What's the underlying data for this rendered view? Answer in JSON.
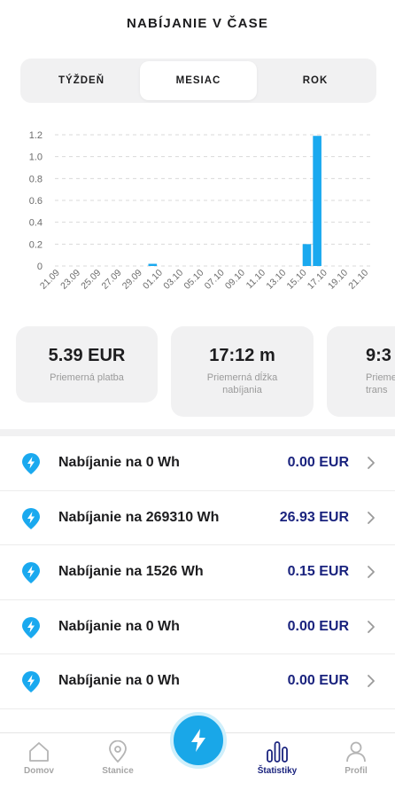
{
  "header": {
    "title": "NABÍJANIE V ČASE"
  },
  "period_tabs": [
    {
      "label": "TÝŽDEŇ",
      "active": false
    },
    {
      "label": "MESIAC",
      "active": true
    },
    {
      "label": "ROK",
      "active": false
    }
  ],
  "chart_data": {
    "type": "bar",
    "categories": [
      "21.09",
      "22.09",
      "23.09",
      "24.09",
      "25.09",
      "26.09",
      "27.09",
      "28.09",
      "29.09",
      "30.09",
      "01.10",
      "02.10",
      "03.10",
      "04.10",
      "05.10",
      "06.10",
      "07.10",
      "08.10",
      "09.10",
      "10.10",
      "11.10",
      "12.10",
      "13.10",
      "14.10",
      "15.10",
      "16.10",
      "17.10",
      "18.10",
      "19.10",
      "20.10",
      "21.10"
    ],
    "tick_labels": [
      "21.09",
      "23.09",
      "25.09",
      "27.09",
      "29.09",
      "01.10",
      "03.10",
      "05.10",
      "07.10",
      "09.10",
      "11.10",
      "13.10",
      "15.10",
      "17.10",
      "19.10",
      "21.10"
    ],
    "values": [
      0,
      0,
      0,
      0,
      0,
      0,
      0,
      0,
      0,
      0.02,
      0,
      0,
      0,
      0,
      0,
      0,
      0,
      0,
      0,
      0,
      0,
      0,
      0,
      0,
      0.2,
      1.19,
      0,
      0,
      0,
      0,
      0
    ],
    "yticks": [
      0,
      0.2,
      0.4,
      0.6,
      0.8,
      1.0,
      1.2
    ],
    "ytick_labels": [
      "0",
      "0.2",
      "0.4",
      "0.6",
      "0.8",
      "1.0",
      "1.2"
    ],
    "ylim": [
      0,
      1.2
    ],
    "grid": true,
    "bar_color": "#1aa9ef",
    "title": "",
    "xlabel": "",
    "ylabel": ""
  },
  "summary_cards": [
    {
      "value": "5.39 EUR",
      "label": "Priemerná platba"
    },
    {
      "value": "17:12 m",
      "label": "Priemerná dĺžka\nnabíjania"
    },
    {
      "value": "9:3",
      "label": "Prieme\ntrans"
    }
  ],
  "sessions": [
    {
      "title": "Nabíjanie na 0 Wh",
      "amount": "0.00 EUR"
    },
    {
      "title": "Nabíjanie na 269310 Wh",
      "amount": "26.93 EUR"
    },
    {
      "title": "Nabíjanie na 1526 Wh",
      "amount": "0.15 EUR"
    },
    {
      "title": "Nabíjanie na 0 Wh",
      "amount": "0.00 EUR"
    },
    {
      "title": "Nabíjanie na 0 Wh",
      "amount": "0.00 EUR"
    }
  ],
  "tabbar": {
    "items": [
      {
        "label": "Domov",
        "icon": "home-icon",
        "active": false
      },
      {
        "label": "Stanice",
        "icon": "location-pin-icon",
        "active": false
      },
      {
        "label": "",
        "icon": "lightning-bolt-icon",
        "active": false
      },
      {
        "label": "Štatistiky",
        "icon": "bar-chart-icon",
        "active": true
      },
      {
        "label": "Profil",
        "icon": "user-icon",
        "active": false
      }
    ]
  },
  "colors": {
    "accent": "#1aa9ef",
    "amount": "#1a237e",
    "card_bg": "#f1f1f2"
  }
}
